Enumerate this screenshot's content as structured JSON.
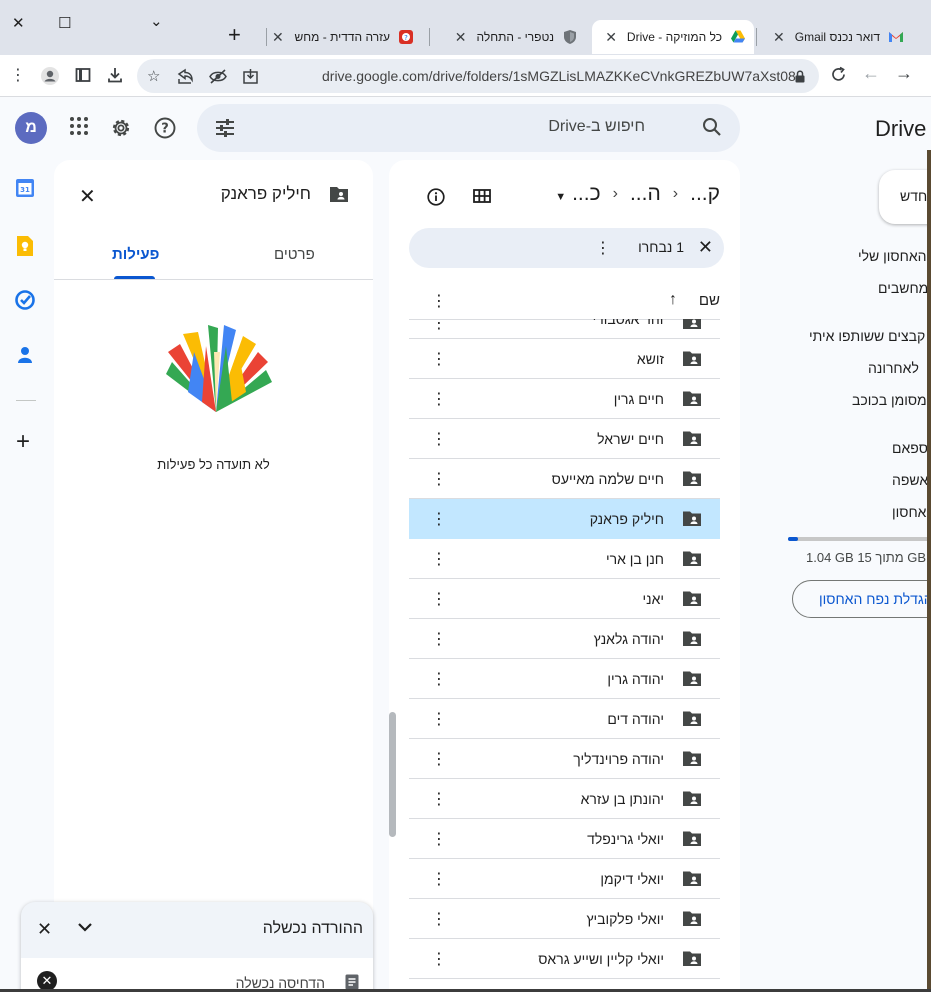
{
  "tabs": [
    {
      "title": "דואר נכנס Gmail",
      "icon": "gmail-icon"
    },
    {
      "title": "כל המוזיקה - Drive",
      "icon": "drive-icon",
      "active": true
    },
    {
      "title": "נטפרי - התחלה",
      "icon": "shield-icon"
    },
    {
      "title": "עזרה הדדית - מחש",
      "icon": "help-icon"
    }
  ],
  "window_controls": {
    "close": "✕",
    "maximize": "☐",
    "minimize": "⌄",
    "new_tab": "+"
  },
  "address_bar": {
    "url": "drive.google.com/drive/folders/1sMGZLisLMAZKKeCVnkGREZbUW7aXst08"
  },
  "header": {
    "app_title": "Drive",
    "search_placeholder": "חיפוש ב-Drive",
    "avatar_letter": "מ"
  },
  "breadcrumb": {
    "items": [
      "ק...",
      "ה...",
      "כ..."
    ]
  },
  "selection": {
    "text": "1 נבחרו"
  },
  "column": {
    "name": "שם"
  },
  "files": [
    {
      "name": "זהר אגסבורי"
    },
    {
      "name": "זושא"
    },
    {
      "name": "חיים גרין"
    },
    {
      "name": "חיים ישראל"
    },
    {
      "name": "חיים שלמה מאייעס"
    },
    {
      "name": "חיליק פראנק",
      "selected": true
    },
    {
      "name": "חנן בן ארי"
    },
    {
      "name": "יאני"
    },
    {
      "name": "יהודה גלאנץ"
    },
    {
      "name": "יהודה גרין"
    },
    {
      "name": "יהודה דים"
    },
    {
      "name": "יהודה פרוינדליך"
    },
    {
      "name": "יהונתן בן עזרא"
    },
    {
      "name": "יואלי גרינפלד"
    },
    {
      "name": "יואלי דיקמן"
    },
    {
      "name": "יואלי פלקוביץ"
    },
    {
      "name": "יואלי קליין ושייע גראס"
    }
  ],
  "details": {
    "title": "חיליק פראנק",
    "tabs": {
      "details": "פרטים",
      "activity": "פעילות"
    },
    "empty_text": "לא תועדה כל פעילות"
  },
  "download": {
    "header": "ההורדה נכשלה",
    "filename": "הדחיסה נכשלה"
  },
  "left_nav": {
    "new_button": "חדש",
    "items": [
      "האחסון שלי",
      "מחשבים",
      "קבצים ששותפו איתי",
      "לאחרונה",
      "מסומן בכוכב",
      "ספאם",
      "אשפה",
      "אחסון"
    ],
    "storage_text": "1.04 GB מתוך 15 GB",
    "storage_fraction": 0.07,
    "storage_button": "הגדלת נפח האחסון"
  },
  "colors": {
    "accent": "#0b57d0",
    "selected_row": "#c2e7ff",
    "search_bg": "#e9eef6"
  }
}
